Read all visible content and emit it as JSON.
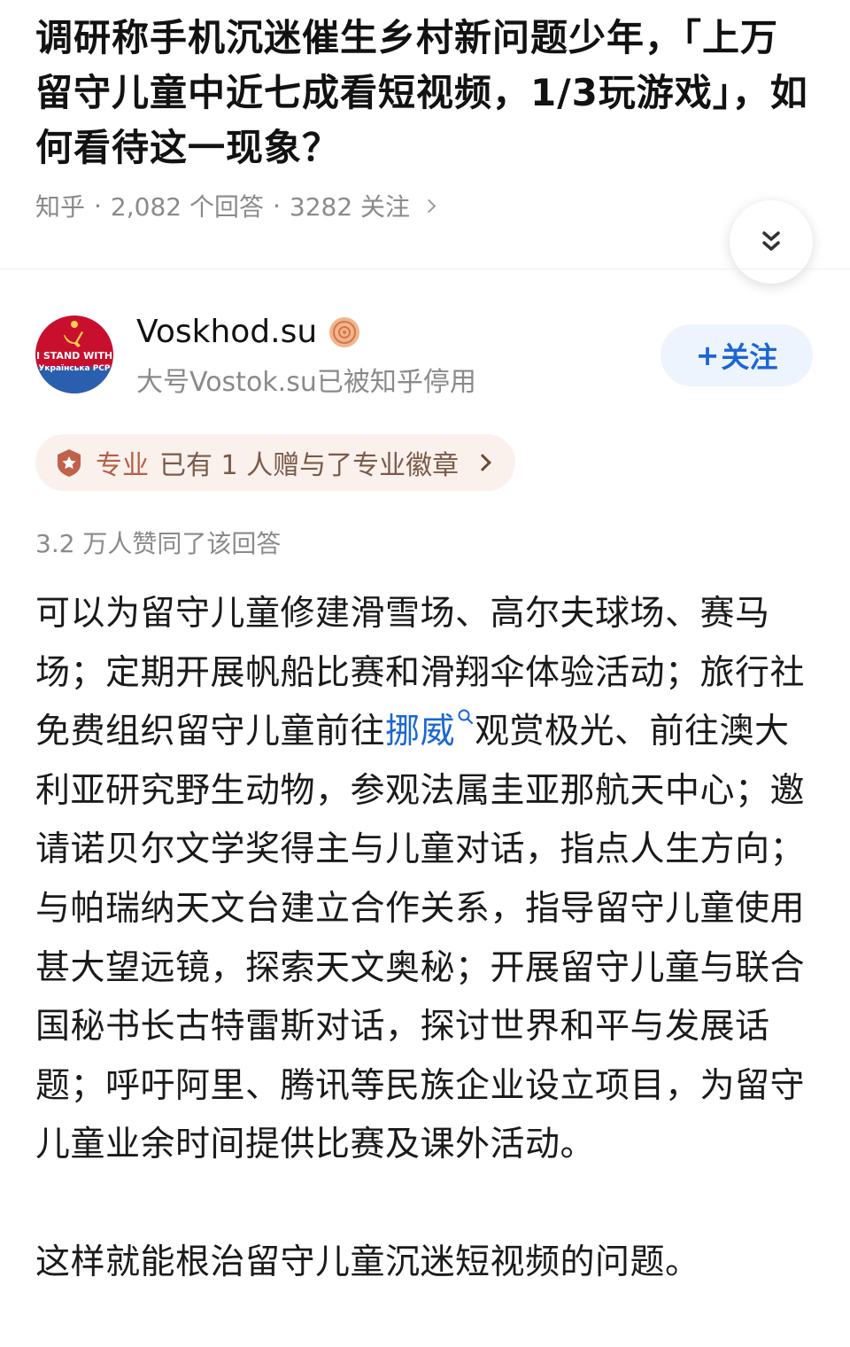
{
  "question": {
    "title": "调研称手机沉迷催生乡村新问题少年，「上万留守儿童中近七成看短视频，1/3玩游戏」，如何看待这一现象？",
    "source": "知乎",
    "answers_count": "2,082 个回答",
    "followers": "3282 关注",
    "separator": "·"
  },
  "author": {
    "name": "Voskhod.su",
    "bio": "大号Vostok.su已被知乎停用",
    "avatar_text_1": "I STAND WITH",
    "avatar_text_2": "Українська РСР"
  },
  "follow_button": {
    "plus": "+",
    "label": "关注"
  },
  "badge": {
    "label": "专业",
    "description": "已有 1 人赠与了专业徽章"
  },
  "votes_text": "3.2 万人赞同了该回答",
  "answer": {
    "para1_before": "可以为留守儿童修建滑雪场、高尔夫球场、赛马场；定期开展帆船比赛和滑翔伞体验活动；旅行社免费组织留守儿童前往",
    "para1_keyword": "挪威",
    "para1_after": "观赏极光、前往澳大利亚研究野生动物，参观法属圭亚那航天中心；邀请诺贝尔文学奖得主与儿童对话，指点人生方向；与帕瑞纳天文台建立合作关系，指导留守儿童使用甚大望远镜，探索天文奥秘；开展留守儿童与联合国秘书长古特雷斯对话，探讨世界和平与发展话题；呼吁阿里、腾讯等民族企业设立项目，为留守儿童业余时间提供比赛及课外活动。",
    "para2": "这样就能根治留守儿童沉迷短视频的问题。"
  },
  "colors": {
    "accent_blue": "#1a66d6",
    "follow_bg": "#eef4fd",
    "badge_bg": "#fbf1ec",
    "badge_icon": "#c0614a",
    "meta_gray": "#8a8a8a"
  },
  "icons": {
    "collapse": "double-chevron-down-icon",
    "certified": "certified-badge-icon",
    "professional": "shield-badge-icon",
    "keyword_search": "search-icon"
  }
}
